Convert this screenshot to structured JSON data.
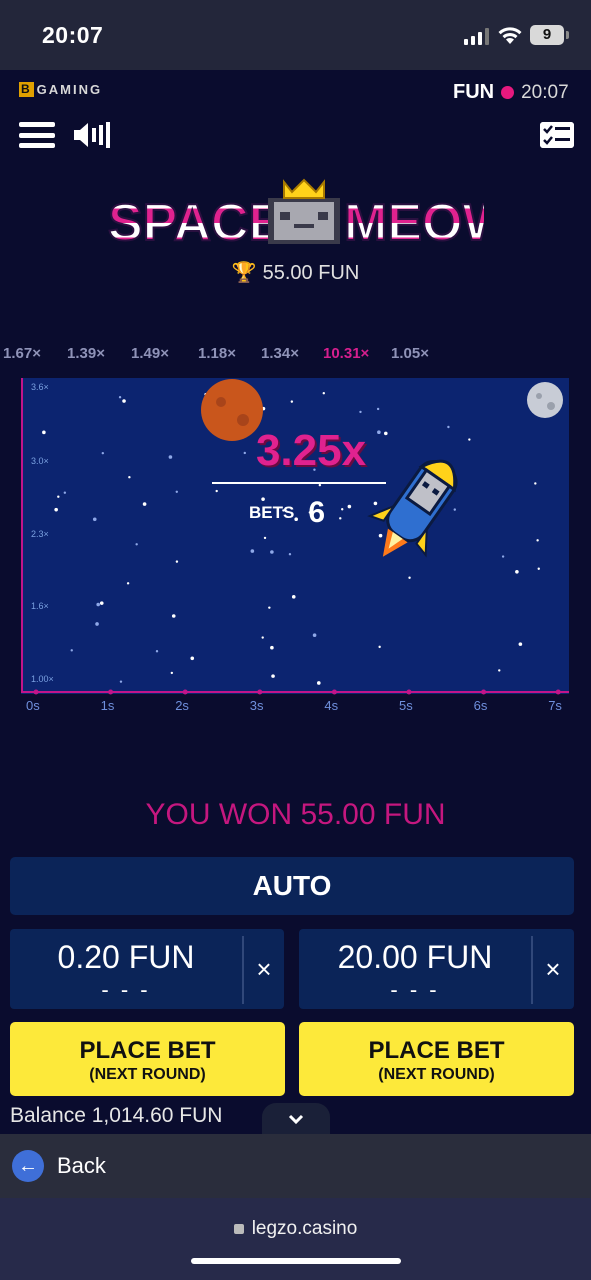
{
  "status_bar": {
    "time": "20:07",
    "battery": "9"
  },
  "header": {
    "brand": "GAMING",
    "brand_letter": "B",
    "mode_label": "FUN",
    "clock": "20:07",
    "logo_text": "SPACE MEOW",
    "top_win": "55.00 FUN"
  },
  "history": [
    "1.67×",
    "1.39×",
    "1.49×",
    "1.18×",
    "1.34×",
    "10.31×",
    "1.05×"
  ],
  "chart_data": {
    "type": "line",
    "multiplier": "3.25x",
    "bets_label": "BETS",
    "bets_count": "6",
    "y_ticks": [
      "3.6×",
      "3.0×",
      "2.3×",
      "1.6×",
      "1.00×"
    ],
    "x_ticks": [
      "0s",
      "1s",
      "2s",
      "3s",
      "4s",
      "5s",
      "6s",
      "7s"
    ],
    "xlim": [
      0,
      7
    ],
    "ylim": [
      1.0,
      3.6
    ]
  },
  "result": {
    "message": "YOU WON 55.00 FUN"
  },
  "controls": {
    "auto_label": "AUTO",
    "bet1": {
      "amount": "0.20 FUN",
      "dashes": "- - -",
      "clear": "×"
    },
    "bet2": {
      "amount": "20.00 FUN",
      "dashes": "- - -",
      "clear": "×"
    },
    "place_bet_label": "PLACE BET",
    "place_bet_sub": "(NEXT ROUND)",
    "balance": "Balance 1,014.60 FUN"
  },
  "browser": {
    "back_label": "Back",
    "url": "legzo.casino"
  },
  "colors": {
    "accent_pink": "#e0228f",
    "button_yellow": "#fde93a",
    "panel_blue": "#0b2458"
  }
}
